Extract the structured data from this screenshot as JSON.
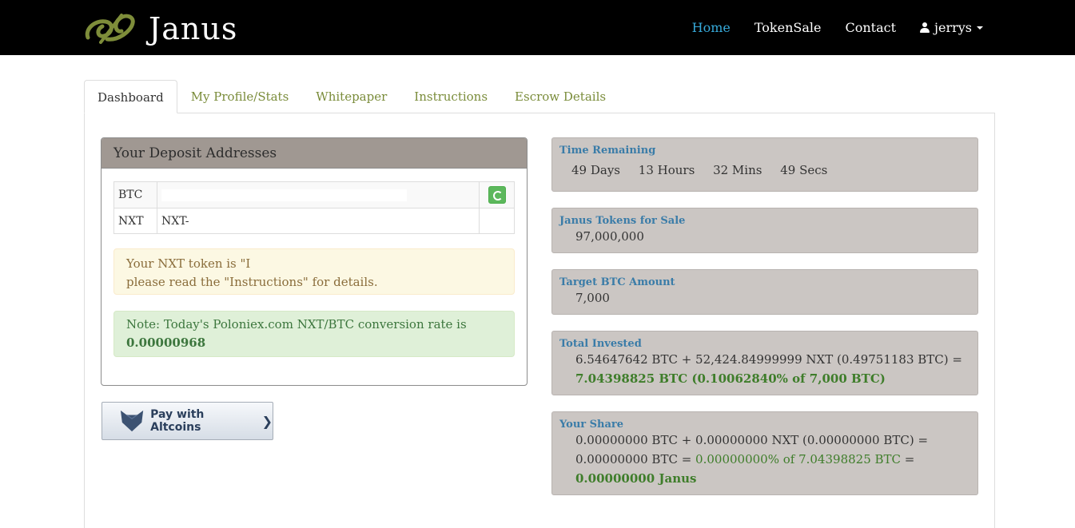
{
  "brand": {
    "name": "Janus"
  },
  "nav": {
    "home": "Home",
    "tokensale": "TokenSale",
    "contact": "Contact",
    "user": "jerrys"
  },
  "tabs": [
    "Dashboard",
    "My Profile/Stats",
    "Whitepaper",
    "Instructions",
    "Escrow Details"
  ],
  "deposit": {
    "title": "Your Deposit Addresses",
    "rows": [
      {
        "currency": "BTC",
        "address": ""
      },
      {
        "currency": "NXT",
        "address": "NXT-"
      }
    ],
    "token_line1": "Your NXT token is \"I",
    "token_line2": "please read the \"Instructions\" for details.",
    "rate_line1": "Note: Today's Poloniex.com NXT/BTC conversion rate is",
    "rate_value": "0.00000968"
  },
  "pay_button": {
    "label": "Pay with Altcoins",
    "chevron": "❯"
  },
  "stats": {
    "time": {
      "title": "Time Remaining",
      "days": "49 Days",
      "hours": "13 Hours",
      "mins": "32 Mins",
      "secs": "49 Secs"
    },
    "tokens": {
      "title": "Janus Tokens for Sale",
      "value": "97,000,000"
    },
    "target": {
      "title": "Target BTC Amount",
      "value": "7,000"
    },
    "invested": {
      "title": "Total Invested",
      "line1": "6.54647642 BTC + 52,424.84999999 NXT (0.49751183 BTC) =",
      "line2": "7.04398825 BTC (0.10062840% of 7,000 BTC)"
    },
    "share": {
      "title": "Your Share",
      "line1": "0.00000000 BTC + 0.00000000 NXT (0.00000000 BTC) =",
      "line2a": "0.00000000 BTC = ",
      "line2b": "0.00000000% of 7.04398825 BTC",
      "line2c": " =",
      "line3": "0.00000000 Janus"
    }
  },
  "colors": {
    "accent": "#36a9d9",
    "tab_text": "#7a8c3a",
    "stat_bg": "#cbc6c3",
    "green": "#3e7d2a"
  }
}
